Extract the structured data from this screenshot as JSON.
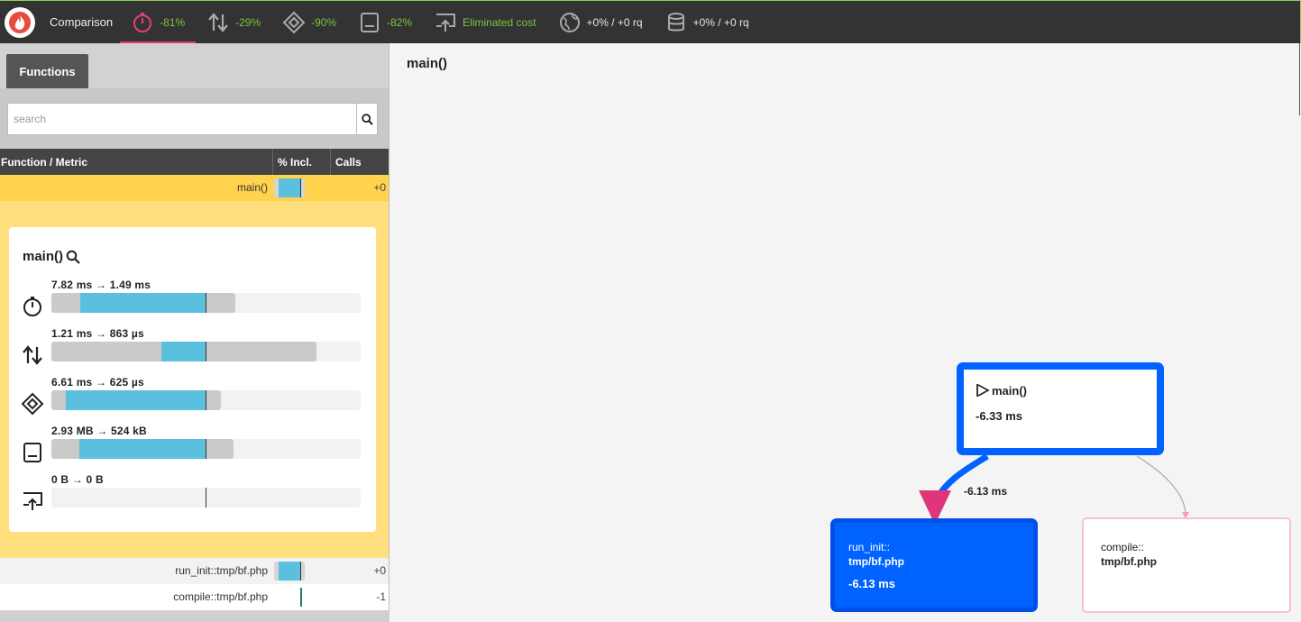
{
  "topbar": {
    "brand": "Comparison",
    "metrics": [
      {
        "icon": "stopwatch-icon",
        "value": "-81%",
        "active": true
      },
      {
        "icon": "io-arrows-icon",
        "value": "-29%"
      },
      {
        "icon": "cpu-icon",
        "value": "-90%"
      },
      {
        "icon": "memory-icon",
        "value": "-82%"
      },
      {
        "icon": "network-icon",
        "value": "Eliminated cost"
      },
      {
        "icon": "globe-icon",
        "value": "+0% / +0 rq"
      },
      {
        "icon": "database-icon",
        "value": "+0% / +0 rq"
      }
    ]
  },
  "sidebar": {
    "tab": "Functions",
    "search_placeholder": "search",
    "columns": [
      "Function / Metric",
      "% Incl.",
      "Calls"
    ],
    "rows": [
      {
        "name": "main()",
        "calls": "+0",
        "bar_fraction": 0.75
      },
      {
        "name": "run_init::tmp/bf.php",
        "calls": "+0",
        "bar_fraction": 0.7
      },
      {
        "name": "compile::tmp/bf.php",
        "calls": "-1",
        "bar_fraction": 0.0
      }
    ]
  },
  "detail": {
    "title": "main()",
    "metrics": [
      {
        "icon": "stopwatch-icon",
        "label": "7.82 ms → 1.49 ms"
      },
      {
        "icon": "io-arrows-icon",
        "label": "1.21 ms → 863 µs"
      },
      {
        "icon": "cpu-icon",
        "label": "6.61 ms → 625 µs"
      },
      {
        "icon": "memory-icon",
        "label": "2.93 MB → 524 kB"
      },
      {
        "icon": "network-icon",
        "label": "0 B → 0 B"
      }
    ]
  },
  "graph": {
    "title": "main()",
    "main_node": {
      "name": "main()",
      "value": "-6.33 ms"
    },
    "run_node": {
      "line1": "run_init::",
      "line2": "tmp/bf.php",
      "value": "-6.13 ms"
    },
    "compile_node": {
      "line1": "compile::",
      "line2": "tmp/bf.php"
    },
    "edge_label": "-6.13 ms"
  },
  "colors": {
    "accent": "#e0407a",
    "improve": "#7cc242",
    "bar": "#5bc0de",
    "node": "#0062ff",
    "selected_row": "#ffd34d"
  }
}
